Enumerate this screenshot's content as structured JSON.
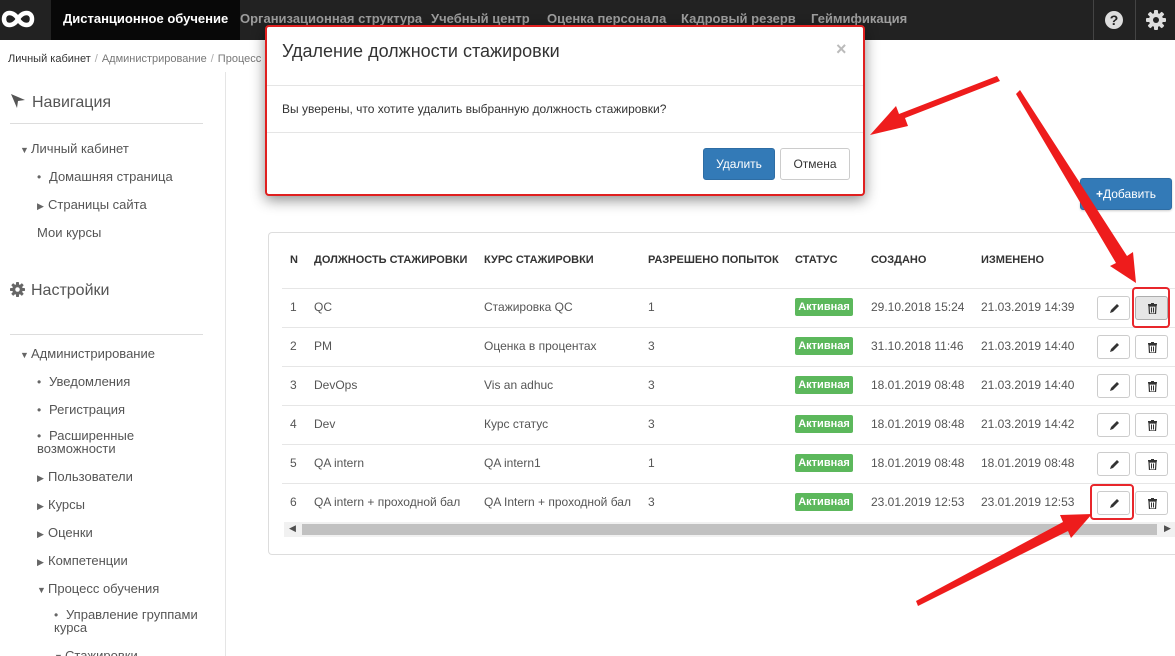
{
  "topbar": {
    "logo_icon": "infinity-logo-icon",
    "items": [
      {
        "label": "Дистанционное обучение",
        "active": true
      },
      {
        "label": "Организационная структура"
      },
      {
        "label": "Учебный центр"
      },
      {
        "label": "Оценка персонала"
      },
      {
        "label": "Кадровый резерв"
      },
      {
        "label": "Геймификация"
      }
    ],
    "help_icon": "question-circle-icon",
    "settings_icon": "gear-icon"
  },
  "breadcrumb": [
    "Личный кабинет",
    "Администрирование",
    "Процесс"
  ],
  "sidebar": {
    "nav_title": "Навигация",
    "nav_items": [
      {
        "label": "Личный кабинет",
        "marker": "▼"
      },
      {
        "label": "Домашняя страница",
        "marker": "•"
      },
      {
        "label": "Страницы сайта",
        "marker": "▶"
      },
      {
        "label": "Мои курсы"
      }
    ],
    "settings_title": "Настройки",
    "settings_items": [
      {
        "label": "Администрирование",
        "marker": "▼"
      },
      {
        "label": "Уведомления",
        "marker": "•"
      },
      {
        "label": "Регистрация",
        "marker": "•"
      },
      {
        "label": "Расширенные",
        "label2": "возможности",
        "marker": "•"
      },
      {
        "label": "Пользователи",
        "marker": "▶"
      },
      {
        "label": "Курсы",
        "marker": "▶"
      },
      {
        "label": "Оценки",
        "marker": "▶"
      },
      {
        "label": "Компетенции",
        "marker": "▶"
      },
      {
        "label": "Процесс обучения",
        "marker": "▼"
      },
      {
        "label": "Управление группами",
        "label2": "курса",
        "marker": "•"
      },
      {
        "label": "Стажировки",
        "marker": "▼"
      }
    ]
  },
  "add_button": {
    "label": "Добавить",
    "icon": "plus-icon"
  },
  "table": {
    "headers": [
      "N",
      "ДОЛЖНОСТЬ СТАЖИРОВКИ",
      "КУРС СТАЖИРОВКИ",
      "РАЗРЕШЕНО ПОПЫТОК",
      "СТАТУС",
      "СОЗДАНО",
      "ИЗМЕНЕНО"
    ],
    "rows": [
      {
        "n": "1",
        "position": "QC",
        "course": "Стажировка QC",
        "attempts": "1",
        "status": "Активная",
        "created": "29.10.2018 15:24",
        "modified": "21.03.2019 14:39"
      },
      {
        "n": "2",
        "position": "PM",
        "course": "Оценка в процентах",
        "attempts": "3",
        "status": "Активная",
        "created": "31.10.2018 11:46",
        "modified": "21.03.2019 14:40"
      },
      {
        "n": "3",
        "position": "DevOps",
        "course": "Vis an adhuc",
        "attempts": "3",
        "status": "Активная",
        "created": "18.01.2019 08:48",
        "modified": "21.03.2019 14:40"
      },
      {
        "n": "4",
        "position": "Dev",
        "course": "Курс статус",
        "attempts": "3",
        "status": "Активная",
        "created": "18.01.2019 08:48",
        "modified": "21.03.2019 14:42"
      },
      {
        "n": "5",
        "position": "QA intern",
        "course": "QA intern1",
        "attempts": "1",
        "status": "Активная",
        "created": "18.01.2019 08:48",
        "modified": "18.01.2019 08:48"
      },
      {
        "n": "6",
        "position": "QA intern + проходной бал",
        "course": "QA Intern + проходной бал",
        "attempts": "3",
        "status": "Активная",
        "created": "23.01.2019 12:53",
        "modified": "23.01.2019 12:53"
      }
    ],
    "edit_icon": "pencil-icon",
    "delete_icon": "trash-icon"
  },
  "modal": {
    "title": "Удаление должности стажировки",
    "close": "×",
    "body": "Вы уверены, что хотите удалить выбранную должность стажировки?",
    "confirm": "Удалить",
    "cancel": "Отмена"
  },
  "colors": {
    "navbar": "#222222",
    "primary": "#337ab7",
    "success": "#5cb85c",
    "annotation": "#e8262b"
  }
}
